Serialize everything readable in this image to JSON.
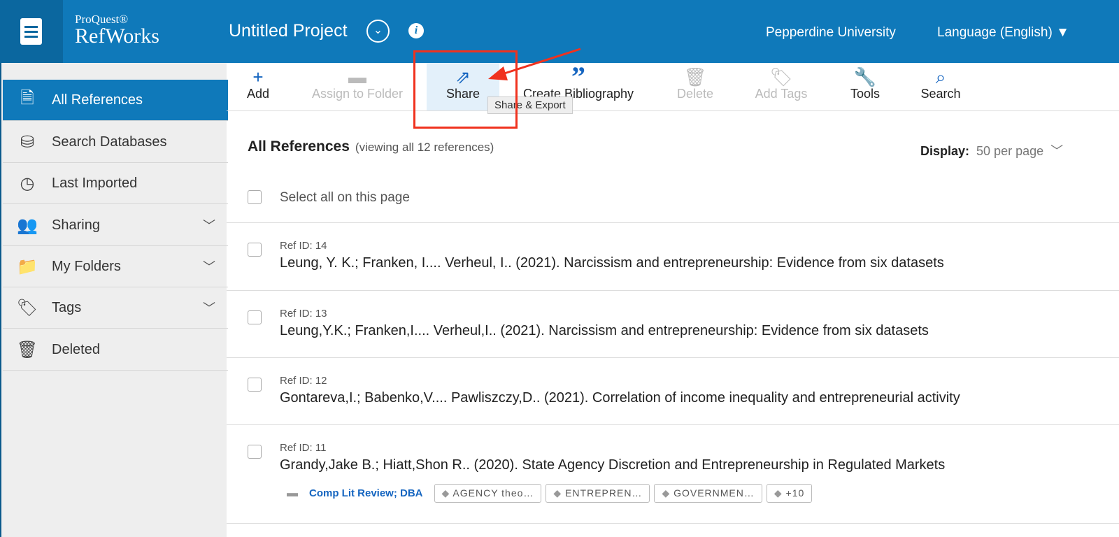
{
  "header": {
    "brand_top": "ProQuest®",
    "brand": "RefWorks",
    "project": "Untitled Project",
    "institution": "Pepperdine University",
    "language": "Language (English) ▼"
  },
  "sidebar": {
    "items": [
      {
        "label": "All References",
        "icon": "document-icon"
      },
      {
        "label": "Search Databases",
        "icon": "database-icon"
      },
      {
        "label": "Last Imported",
        "icon": "clock-icon"
      },
      {
        "label": "Sharing",
        "icon": "people-icon"
      },
      {
        "label": "My Folders",
        "icon": "folder-icon"
      },
      {
        "label": "Tags",
        "icon": "tag-icon"
      },
      {
        "label": "Deleted",
        "icon": "trash-icon"
      }
    ]
  },
  "toolbar": {
    "add": "Add",
    "assign": "Assign to Folder",
    "share": "Share",
    "bibliography": "Create Bibliography",
    "delete": "Delete",
    "tags": "Add Tags",
    "tools": "Tools",
    "search": "Search",
    "tooltip": "Share & Export"
  },
  "main": {
    "title": "All References",
    "subtitle": "(viewing all 12 references)",
    "display_label": "Display:",
    "display_value": "50 per page",
    "select_all": "Select all on this page",
    "refs": [
      {
        "id": "Ref ID: 14",
        "text": "Leung, Y. K.; Franken, I.... Verheul, I.. (2021). Narcissism and entrepreneurship: Evidence from six datasets"
      },
      {
        "id": "Ref ID: 13",
        "text": "Leung,Y.K.; Franken,I.... Verheul,I.. (2021). Narcissism and entrepreneurship: Evidence from six datasets"
      },
      {
        "id": "Ref ID: 12",
        "text": "Gontareva,I.; Babenko,V.... Pawliszczy,D.. (2021). Correlation of income inequality and entrepreneurial activity"
      },
      {
        "id": "Ref ID: 11",
        "text": "Grandy,Jake B.; Hiatt,Shon R.. (2020). State Agency Discretion and Entrepreneurship in Regulated Markets"
      }
    ],
    "ref11_folders": "Comp Lit Review; DBA",
    "ref11_tags": [
      "AGENCY theo…",
      "ENTREPREN…",
      "GOVERNMEN…",
      "+10"
    ]
  },
  "colors": {
    "brand": "#0f79ba",
    "annotation": "#f0321e"
  }
}
